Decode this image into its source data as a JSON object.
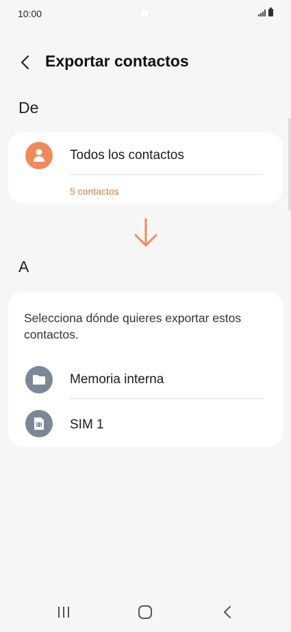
{
  "status": {
    "time": "10:00"
  },
  "header": {
    "title": "Exportar contactos"
  },
  "from": {
    "label": "De",
    "item_label": "Todos los contactos",
    "count": "5 contactos",
    "accent": "#ef8a5a"
  },
  "to": {
    "label": "A",
    "description": "Selecciona dónde quieres exportar estos contactos.",
    "options": [
      {
        "label": "Memoria interna",
        "icon": "folder-icon"
      },
      {
        "label": "SIM 1",
        "icon": "sim-card-icon"
      }
    ],
    "icon_color": "#7a8898"
  },
  "colors": {
    "arrow": "#ef8a5a",
    "count_text": "#e07a3c"
  }
}
